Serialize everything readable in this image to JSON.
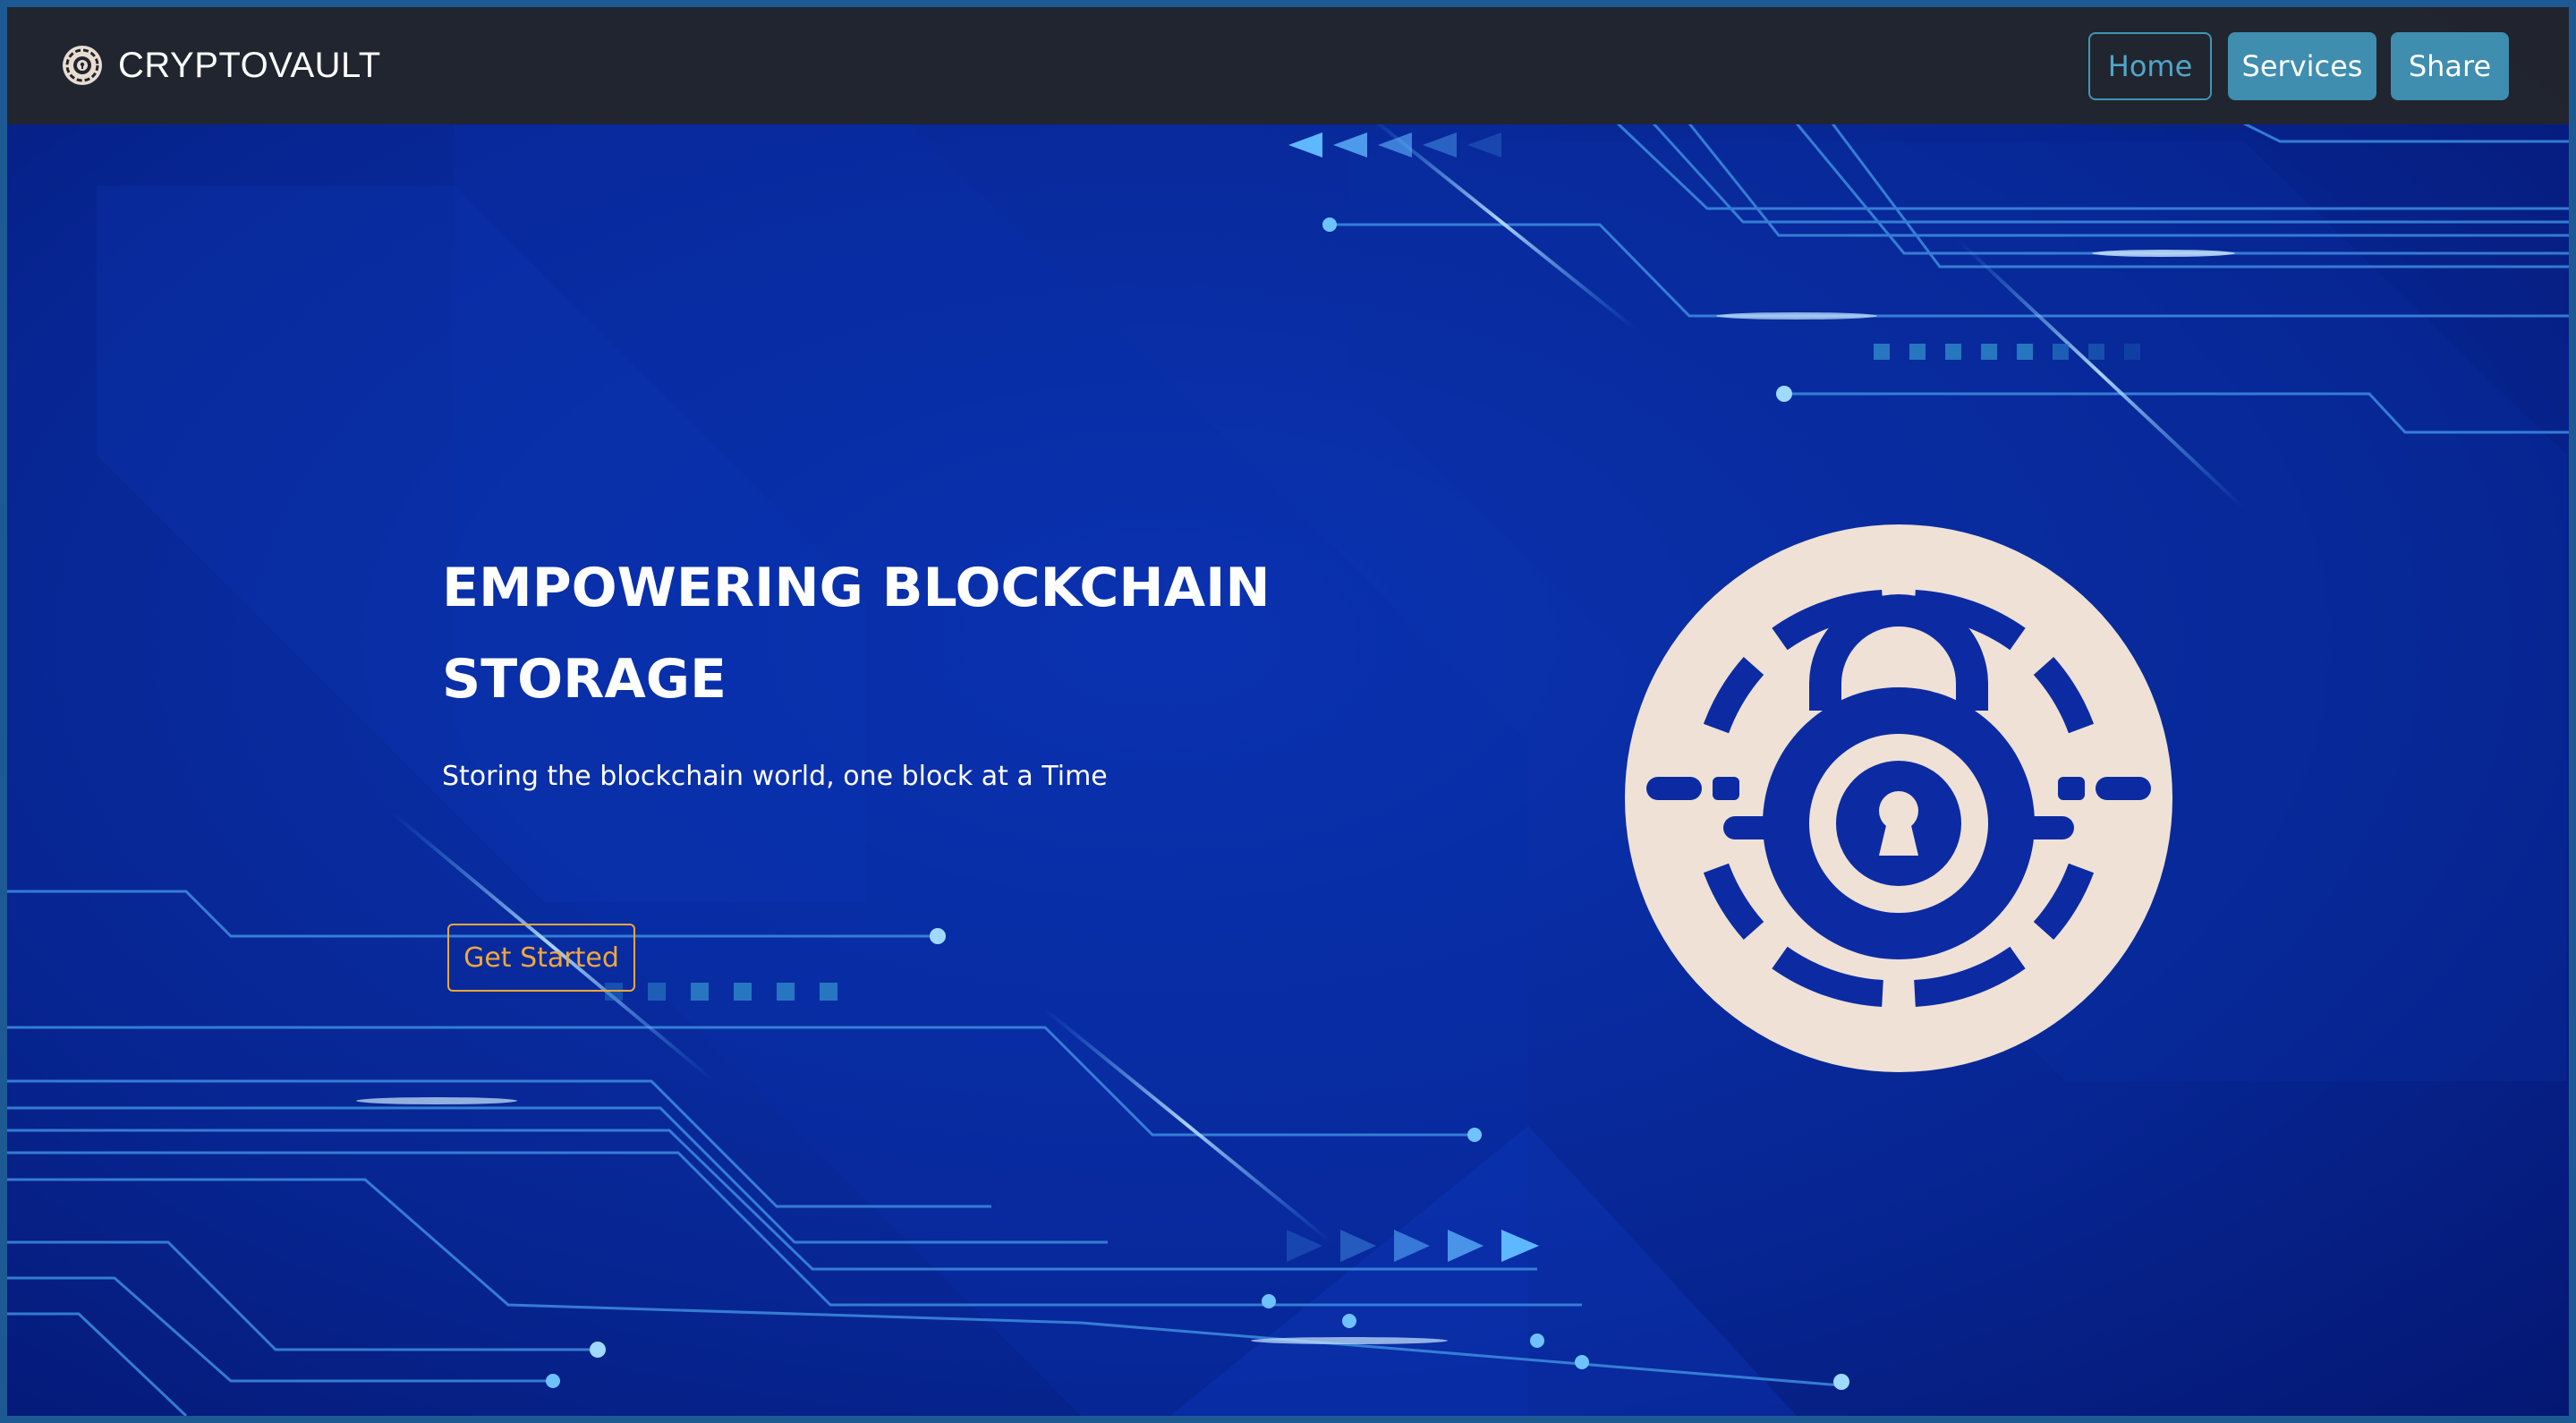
{
  "navbar": {
    "brand": "CRYPTOVAULT",
    "brand_icon": "vault-logo-icon",
    "links": [
      {
        "label": "Home",
        "style": "outline"
      },
      {
        "label": "Services",
        "style": "filled"
      },
      {
        "label": "Share",
        "style": "filled"
      }
    ]
  },
  "hero": {
    "title": "EMPOWERING BLOCKCHAIN STORAGE",
    "subtitle": "Storing the blockchain world, one block at a Time",
    "cta_label": "Get Started",
    "illustration": "padlock-vault-icon"
  },
  "colors": {
    "navbar_bg": "#22252c",
    "hero_bg": "#061e7a",
    "accent_teal": "#3f8daf",
    "cta_orange": "#f0a73a",
    "vault_fill": "#efe1d6"
  }
}
